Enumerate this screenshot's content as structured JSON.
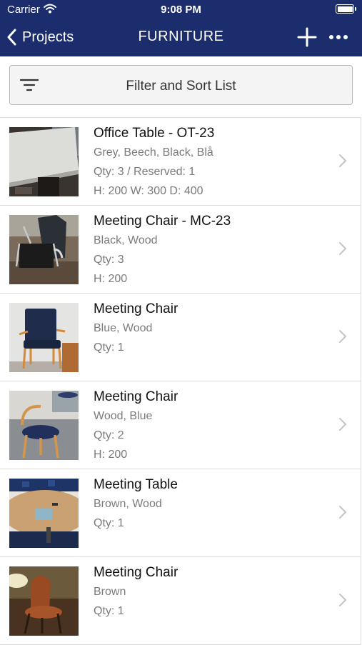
{
  "status_bar": {
    "carrier": "Carrier",
    "time": "9:08 PM"
  },
  "nav": {
    "back_label": "Projects",
    "title": "FURNITURE"
  },
  "filter": {
    "label": "Filter and Sort List"
  },
  "items": [
    {
      "title": "Office Table - OT-23",
      "colors": "Grey, Beech, Black, Blå",
      "qty": "Qty: 3 / Reserved: 1",
      "dims": "H: 200 W: 300 D: 400"
    },
    {
      "title": "Meeting Chair - MC-23",
      "colors": "Black, Wood",
      "qty": "Qty: 3",
      "dims": "H: 200"
    },
    {
      "title": "Meeting Chair",
      "colors": "Blue, Wood",
      "qty": "Qty: 1",
      "dims": ""
    },
    {
      "title": "Meeting Chair",
      "colors": "Wood, Blue",
      "qty": "Qty: 2",
      "dims": "H: 200"
    },
    {
      "title": "Meeting Table",
      "colors": "Brown, Wood",
      "qty": "Qty: 1",
      "dims": ""
    },
    {
      "title": "Meeting Chair",
      "colors": "Brown",
      "qty": "Qty: 1",
      "dims": ""
    }
  ],
  "colors": {
    "nav_bar": "#1b2d6d",
    "secondary_text": "#7a7a7a",
    "divider": "#dcdcdc"
  }
}
